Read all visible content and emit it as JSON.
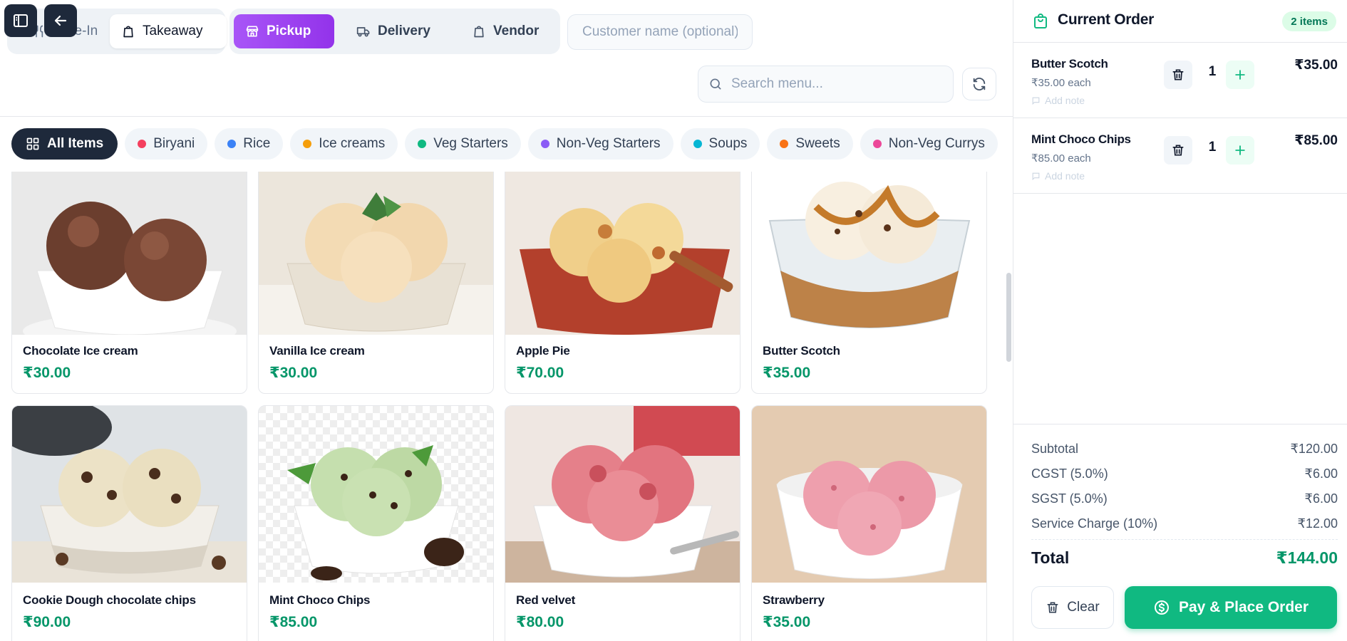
{
  "colors": {
    "accent_purple": "#a855f7",
    "accent_green": "#10b981",
    "price_green": "#059669",
    "dark": "#1e293b"
  },
  "order_types": {
    "group1": [
      {
        "label": "Dine-In",
        "icon": "utensils-icon"
      },
      {
        "label": "Takeaway",
        "icon": "bag-icon",
        "selected": true
      }
    ],
    "group2": [
      {
        "label": "Pickup",
        "icon": "store-icon",
        "selected": true
      },
      {
        "label": "Delivery",
        "icon": "truck-icon"
      },
      {
        "label": "Vendor",
        "icon": "bag-icon"
      }
    ]
  },
  "customer": {
    "placeholder": "Customer name (optional)",
    "value": ""
  },
  "search": {
    "placeholder": "Search menu...",
    "value": ""
  },
  "categories": [
    {
      "label": "All Items",
      "active": true,
      "icon": "grid-icon"
    },
    {
      "label": "Biryani",
      "color": "#f43f5e"
    },
    {
      "label": "Rice",
      "color": "#3b82f6"
    },
    {
      "label": "Ice creams",
      "color": "#f59e0b"
    },
    {
      "label": "Veg Starters",
      "color": "#10b981"
    },
    {
      "label": "Non-Veg Starters",
      "color": "#8b5cf6"
    },
    {
      "label": "Soups",
      "color": "#06b6d4"
    },
    {
      "label": "Sweets",
      "color": "#f97316"
    },
    {
      "label": "Non-Veg Currys",
      "color": "#ec4899"
    }
  ],
  "menu_items": [
    {
      "name": "Chocolate Ice cream",
      "price": "₹30.00"
    },
    {
      "name": "Vanilla Ice cream",
      "price": "₹30.00"
    },
    {
      "name": "Apple Pie",
      "price": "₹70.00"
    },
    {
      "name": "Butter Scotch",
      "price": "₹35.00"
    },
    {
      "name": "Cookie Dough chocolate chips",
      "price": "₹90.00"
    },
    {
      "name": "Mint Choco Chips",
      "price": "₹85.00"
    },
    {
      "name": "Red velvet",
      "price": "₹80.00"
    },
    {
      "name": "Strawberry",
      "price": "₹35.00"
    }
  ],
  "order": {
    "title": "Current Order",
    "count": "2 items",
    "items": [
      {
        "name": "Butter Scotch",
        "each": "₹35.00 each",
        "note": "Add note",
        "qty": "1",
        "total": "₹35.00"
      },
      {
        "name": "Mint Choco Chips",
        "each": "₹85.00 each",
        "note": "Add note",
        "qty": "1",
        "total": "₹85.00"
      }
    ],
    "summary": [
      {
        "label": "Subtotal",
        "value": "₹120.00"
      },
      {
        "label": "CGST (5.0%)",
        "value": "₹6.00"
      },
      {
        "label": "SGST (5.0%)",
        "value": "₹6.00"
      },
      {
        "label": "Service Charge (10%)",
        "value": "₹12.00"
      }
    ],
    "total_label": "Total",
    "total_value": "₹144.00",
    "clear_label": "Clear",
    "pay_label": "Pay & Place Order"
  }
}
